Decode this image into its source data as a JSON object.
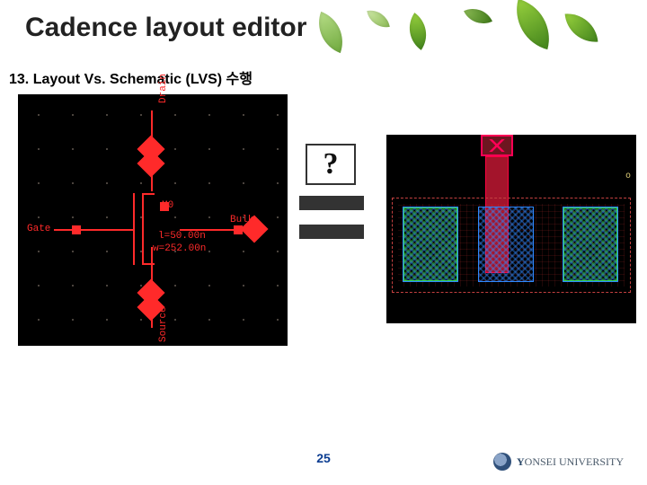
{
  "slide": {
    "title": "Cadence layout editor",
    "subtitle": "13. Layout Vs. Schematic (LVS) 수행",
    "page_number": "25"
  },
  "schematic": {
    "port_top": "Drain",
    "port_left": "Gate",
    "port_right": "Bulk",
    "port_bottom": "Source",
    "device_name": "M0",
    "param_l": "l=50.00n",
    "param_w": "w=252.00n"
  },
  "lvs": {
    "mark": "?"
  },
  "layout": {
    "label_right": "o"
  },
  "footer": {
    "university": "YONSEI UNIVERSITY"
  }
}
